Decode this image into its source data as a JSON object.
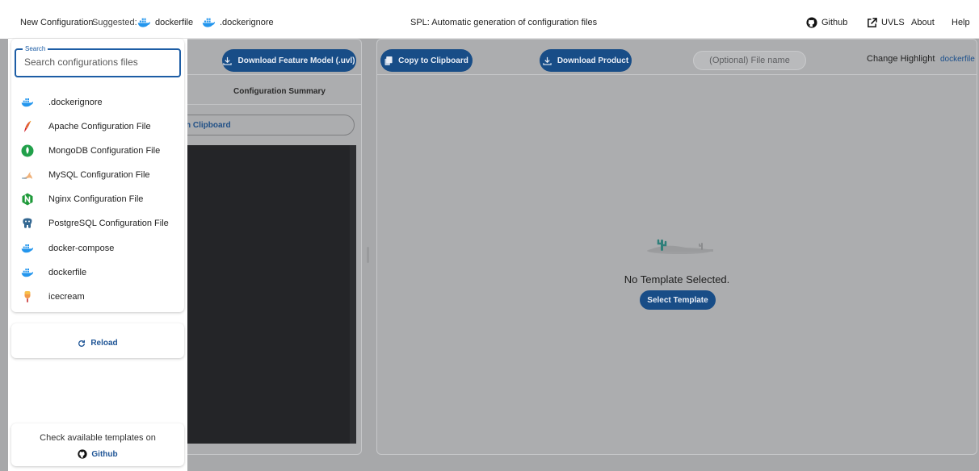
{
  "topbar": {
    "new_config": "New Configuration",
    "suggested_label": "Suggested:",
    "suggestions": [
      "dockerfile",
      ".dockerignore"
    ],
    "title": "SPL: Automatic generation of configuration files",
    "github": "Github",
    "uvls": "UVLS",
    "about": "About",
    "help": "Help"
  },
  "feature_panel": {
    "download_model": "Download Feature Model (.uvl)",
    "summary_tab": "Configuration Summary",
    "copy_partial": "n Clipboard"
  },
  "product_panel": {
    "copy": "Copy to Clipboard",
    "download": "Download Product",
    "filename_placeholder": "(Optional) File name",
    "change_highlight": "Change Highlight",
    "highlight_value": "dockerfile",
    "empty_text": "No Template Selected.",
    "select_template": "Select Template"
  },
  "sidebar": {
    "search_legend": "Search",
    "search_placeholder": "Search configurations files",
    "items": [
      {
        "label": ".dockerignore",
        "icon": "docker-icon"
      },
      {
        "label": "Apache Configuration File",
        "icon": "apache-feather-icon"
      },
      {
        "label": "MongoDB Configuration File",
        "icon": "mongodb-leaf-icon"
      },
      {
        "label": "MySQL Configuration File",
        "icon": "mysql-dolphin-icon"
      },
      {
        "label": "Nginx Configuration File",
        "icon": "nginx-icon"
      },
      {
        "label": "PostgreSQL Configuration File",
        "icon": "postgresql-elephant-icon"
      },
      {
        "label": "docker-compose",
        "icon": "docker-icon"
      },
      {
        "label": "dockerfile",
        "icon": "docker-icon"
      },
      {
        "label": "icecream",
        "icon": "icecream-icon"
      }
    ],
    "reload": "Reload",
    "templates_text": "Check available templates on",
    "templates_link": "Github"
  },
  "colors": {
    "accent": "#184d87",
    "link": "#1f5596",
    "overlay": "#a7a8aa",
    "docker": "#2496ed"
  }
}
